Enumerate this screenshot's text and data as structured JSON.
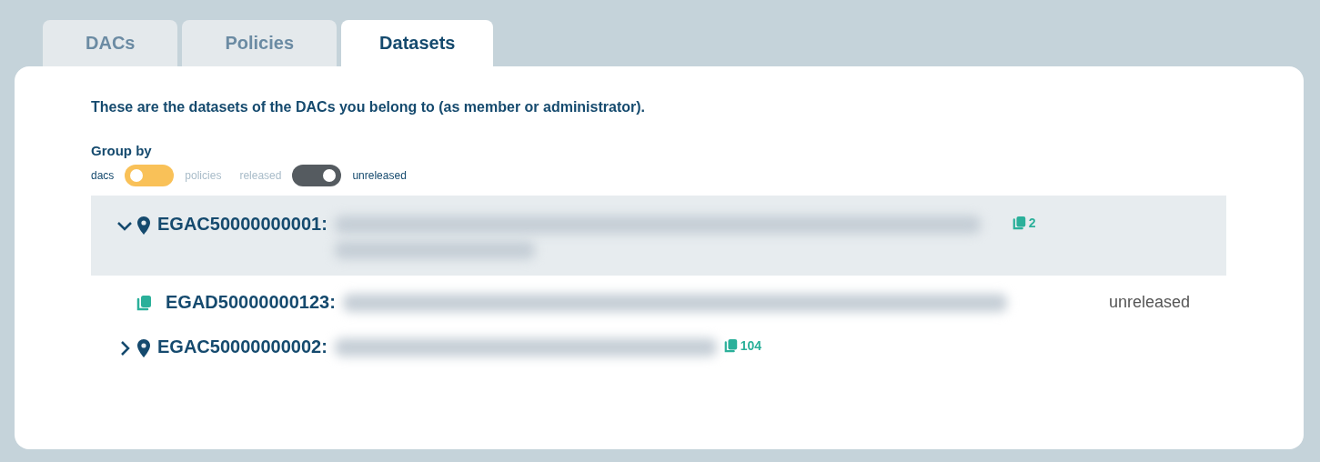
{
  "tabs": [
    {
      "label": "DACs",
      "selected": false
    },
    {
      "label": "Policies",
      "selected": false
    },
    {
      "label": "Datasets",
      "selected": true
    }
  ],
  "intro": "These are the datasets of the DACs you belong to (as member or administrator).",
  "group_by": {
    "title": "Group by",
    "toggles": [
      {
        "options": [
          {
            "label": "dacs",
            "selected": true
          },
          {
            "label": "policies",
            "selected": false
          }
        ]
      },
      {
        "options": [
          {
            "label": "released",
            "selected": false
          },
          {
            "label": "unreleased",
            "selected": true
          }
        ]
      }
    ]
  },
  "dacs": [
    {
      "id": "EGAC50000000001:",
      "expanded": true,
      "count": "2",
      "children": [
        {
          "id": "EGAD50000000123:",
          "status": "unreleased"
        }
      ]
    },
    {
      "id": "EGAC50000000002:",
      "expanded": false,
      "count": "104"
    }
  ]
}
